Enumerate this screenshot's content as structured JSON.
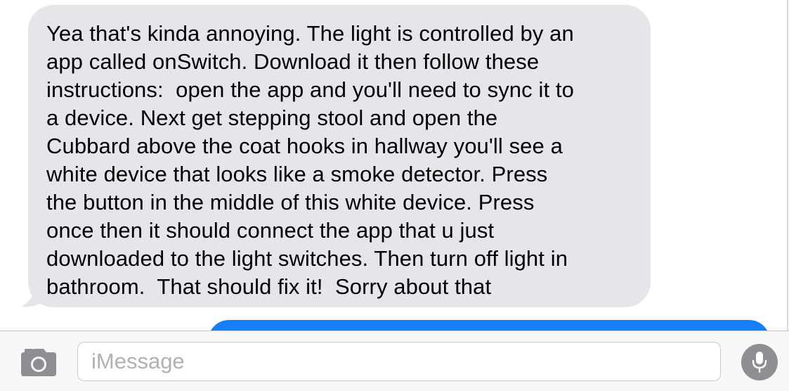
{
  "conversation": {
    "incoming_message": "Yea that's kinda annoying. The light is controlled by an\napp called onSwitch. Download it then follow these\ninstructions:  open the app and you'll need to sync it to\na device. Next get stepping stool and open the\nCubbard above the coat hooks in hallway you'll see a\nwhite device that looks like a smoke detector. Press\nthe button in the middle of this white device. Press\nonce then it should connect the app that u just\ndownloaded to the light switches. Then turn off light in\nbathroom.  That should fix it!  Sorry about that",
    "incoming_bubble_color": "#e5e5ea",
    "outgoing_bubble_color": "#147efb"
  },
  "composer": {
    "camera_icon": "camera-icon",
    "placeholder": "iMessage",
    "value": "",
    "mic_icon": "microphone-icon"
  }
}
